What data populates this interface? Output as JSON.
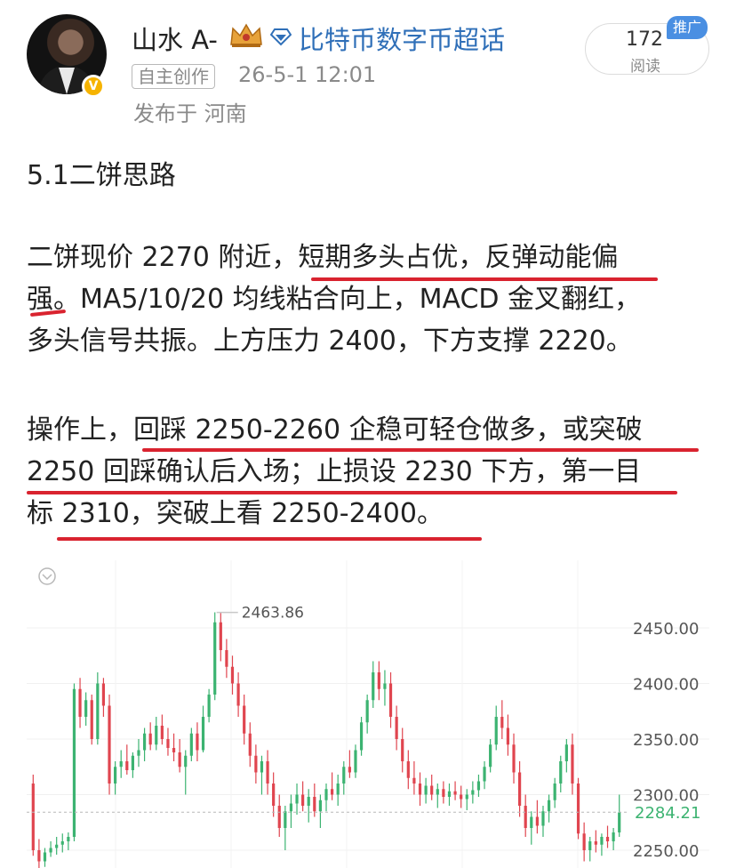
{
  "header": {
    "username": "山水 A-",
    "topic": "比特币数字币超话",
    "tag": "自主创作",
    "time": "26-5-1 12:01",
    "location": "发布于 河南",
    "read_count": "172",
    "read_label": "阅读",
    "push_tag": "推广",
    "verified_icon": "v-badge-icon",
    "crown_icon": "crown-icon",
    "topic_icon": "diamond-icon"
  },
  "post": {
    "title": "5.1二饼思路",
    "para1_lines": [
      "二饼现价 2270 附近，短期多头占优，反弹动能偏",
      "强。MA5/10/20 均线粘合向上，MACD 金叉翻红，",
      "多头信号共振。上方压力 2400，下方支撑 2220。"
    ],
    "para2_lines": [
      "操作上，回踩 2250-2260 企稳可轻仓做多，或突破",
      "2250 回踩确认后入场；止损设 2230 下方，第一目",
      "标 2310，突破上看 2250-2400。"
    ]
  },
  "chart_data": {
    "type": "candlestick",
    "y_ticks": [
      "2450.00",
      "2400.00",
      "2350.00",
      "2300.00",
      "2250.00"
    ],
    "current_price": "2284.21",
    "high_label": "2463.86",
    "ylim": [
      2240,
      2480
    ],
    "up_color": "#3cb371",
    "down_color": "#e0454f",
    "collapse_icon": "chevron-down-icon",
    "candles": [
      [
        2310,
        2318,
        2245,
        2250
      ],
      [
        2250,
        2260,
        2230,
        2240
      ],
      [
        2240,
        2252,
        2235,
        2248
      ],
      [
        2248,
        2258,
        2244,
        2252
      ],
      [
        2252,
        2262,
        2246,
        2255
      ],
      [
        2255,
        2265,
        2248,
        2258
      ],
      [
        2258,
        2266,
        2250,
        2262
      ],
      [
        2262,
        2400,
        2258,
        2395
      ],
      [
        2395,
        2405,
        2360,
        2370
      ],
      [
        2370,
        2392,
        2362,
        2385
      ],
      [
        2385,
        2390,
        2345,
        2350
      ],
      [
        2350,
        2410,
        2345,
        2400
      ],
      [
        2400,
        2405,
        2370,
        2380
      ],
      [
        2380,
        2390,
        2300,
        2310
      ],
      [
        2310,
        2330,
        2300,
        2325
      ],
      [
        2325,
        2340,
        2315,
        2330
      ],
      [
        2330,
        2345,
        2318,
        2322
      ],
      [
        2322,
        2338,
        2315,
        2335
      ],
      [
        2335,
        2350,
        2325,
        2340
      ],
      [
        2340,
        2360,
        2330,
        2355
      ],
      [
        2355,
        2365,
        2340,
        2345
      ],
      [
        2345,
        2370,
        2340,
        2362
      ],
      [
        2362,
        2372,
        2345,
        2350
      ],
      [
        2350,
        2360,
        2335,
        2342
      ],
      [
        2342,
        2355,
        2330,
        2338
      ],
      [
        2338,
        2350,
        2320,
        2325
      ],
      [
        2325,
        2340,
        2300,
        2335
      ],
      [
        2335,
        2360,
        2330,
        2355
      ],
      [
        2355,
        2365,
        2330,
        2340
      ],
      [
        2340,
        2380,
        2338,
        2370
      ],
      [
        2370,
        2395,
        2365,
        2390
      ],
      [
        2390,
        2464,
        2385,
        2455
      ],
      [
        2455,
        2464,
        2420,
        2430
      ],
      [
        2430,
        2440,
        2405,
        2415
      ],
      [
        2415,
        2425,
        2390,
        2400
      ],
      [
        2400,
        2410,
        2370,
        2380
      ],
      [
        2380,
        2390,
        2345,
        2355
      ],
      [
        2355,
        2365,
        2325,
        2335
      ],
      [
        2335,
        2345,
        2310,
        2320
      ],
      [
        2320,
        2335,
        2300,
        2330
      ],
      [
        2330,
        2340,
        2300,
        2310
      ],
      [
        2310,
        2320,
        2280,
        2290
      ],
      [
        2290,
        2300,
        2262,
        2270
      ],
      [
        2270,
        2290,
        2250,
        2285
      ],
      [
        2285,
        2300,
        2270,
        2292
      ],
      [
        2292,
        2310,
        2282,
        2300
      ],
      [
        2300,
        2312,
        2285,
        2290
      ],
      [
        2290,
        2305,
        2275,
        2298
      ],
      [
        2298,
        2310,
        2280,
        2285
      ],
      [
        2285,
        2300,
        2270,
        2295
      ],
      [
        2295,
        2310,
        2285,
        2305
      ],
      [
        2305,
        2320,
        2295,
        2300
      ],
      [
        2300,
        2318,
        2290,
        2310
      ],
      [
        2310,
        2330,
        2300,
        2325
      ],
      [
        2325,
        2340,
        2315,
        2320
      ],
      [
        2320,
        2345,
        2315,
        2340
      ],
      [
        2340,
        2370,
        2335,
        2365
      ],
      [
        2365,
        2390,
        2355,
        2385
      ],
      [
        2385,
        2420,
        2378,
        2410
      ],
      [
        2410,
        2420,
        2385,
        2395
      ],
      [
        2395,
        2412,
        2380,
        2400
      ],
      [
        2400,
        2410,
        2360,
        2370
      ],
      [
        2370,
        2380,
        2340,
        2350
      ],
      [
        2350,
        2360,
        2320,
        2330
      ],
      [
        2330,
        2340,
        2305,
        2315
      ],
      [
        2315,
        2330,
        2300,
        2310
      ],
      [
        2310,
        2320,
        2290,
        2300
      ],
      [
        2300,
        2315,
        2292,
        2308
      ],
      [
        2308,
        2318,
        2295,
        2300
      ],
      [
        2300,
        2310,
        2288,
        2305
      ],
      [
        2305,
        2312,
        2292,
        2298
      ],
      [
        2298,
        2310,
        2290,
        2303
      ],
      [
        2303,
        2312,
        2295,
        2300
      ],
      [
        2300,
        2308,
        2288,
        2296
      ],
      [
        2296,
        2305,
        2286,
        2300
      ],
      [
        2300,
        2312,
        2292,
        2304
      ],
      [
        2304,
        2318,
        2298,
        2312
      ],
      [
        2312,
        2330,
        2305,
        2325
      ],
      [
        2325,
        2350,
        2320,
        2345
      ],
      [
        2345,
        2380,
        2340,
        2370
      ],
      [
        2370,
        2385,
        2350,
        2360
      ],
      [
        2360,
        2372,
        2335,
        2345
      ],
      [
        2345,
        2355,
        2310,
        2320
      ],
      [
        2320,
        2330,
        2280,
        2290
      ],
      [
        2290,
        2300,
        2262,
        2270
      ],
      [
        2270,
        2285,
        2255,
        2280
      ],
      [
        2280,
        2295,
        2265,
        2272
      ],
      [
        2272,
        2290,
        2262,
        2285
      ],
      [
        2285,
        2300,
        2275,
        2295
      ],
      [
        2295,
        2315,
        2288,
        2310
      ],
      [
        2310,
        2335,
        2302,
        2330
      ],
      [
        2330,
        2350,
        2320,
        2345
      ],
      [
        2345,
        2355,
        2300,
        2310
      ],
      [
        2310,
        2315,
        2260,
        2265
      ],
      [
        2265,
        2275,
        2240,
        2250
      ],
      [
        2250,
        2262,
        2240,
        2258
      ],
      [
        2258,
        2268,
        2248,
        2255
      ],
      [
        2255,
        2265,
        2245,
        2262
      ],
      [
        2262,
        2272,
        2252,
        2258
      ],
      [
        2258,
        2270,
        2250,
        2266
      ],
      [
        2266,
        2300,
        2262,
        2284
      ]
    ]
  }
}
